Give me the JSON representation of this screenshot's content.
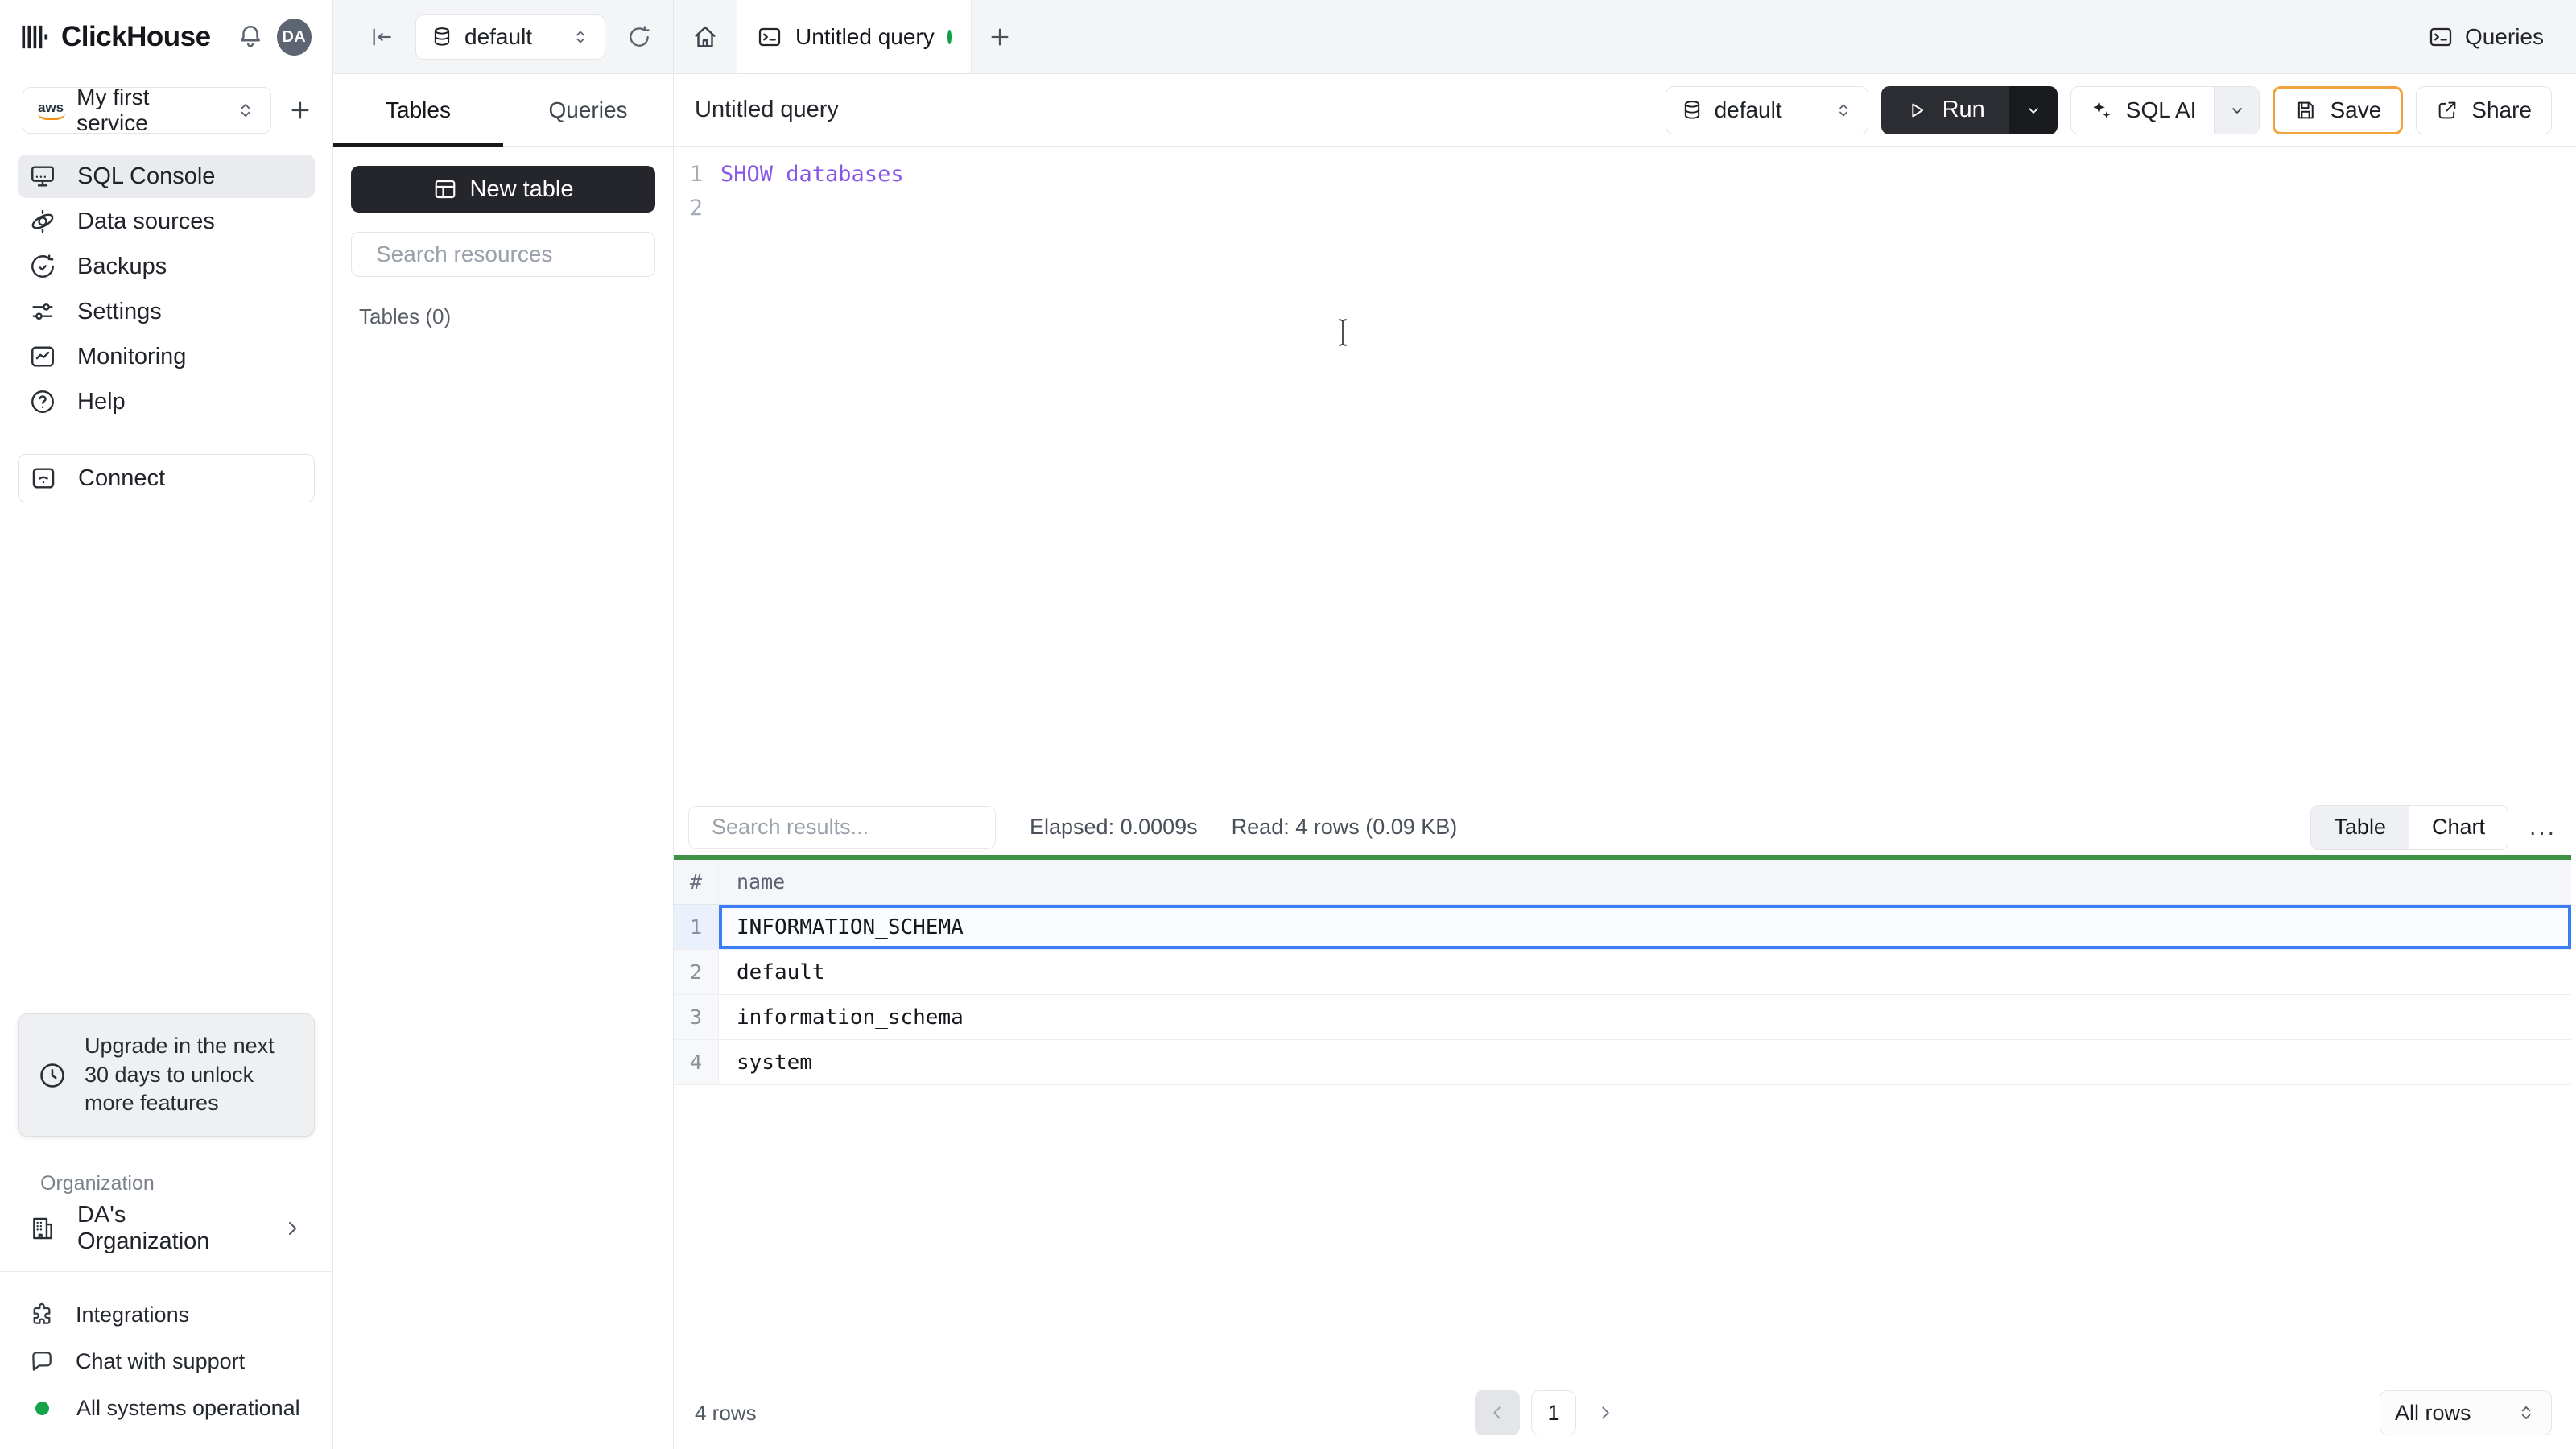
{
  "header": {
    "brand": "ClickHouse",
    "avatar_initials": "DA",
    "queries_button": "Queries"
  },
  "topbar": {
    "database": "default",
    "tab_title": "Untitled query"
  },
  "sidebar": {
    "service": "My first service",
    "items": [
      {
        "label": "SQL Console"
      },
      {
        "label": "Data sources"
      },
      {
        "label": "Backups"
      },
      {
        "label": "Settings"
      },
      {
        "label": "Monitoring"
      },
      {
        "label": "Help"
      }
    ],
    "connect": "Connect",
    "upgrade": "Upgrade in the next 30 days to unlock more features",
    "org_label": "Organization",
    "org_name": "DA's Organization",
    "footer": [
      {
        "label": "Integrations"
      },
      {
        "label": "Chat with support"
      },
      {
        "label": "All systems operational"
      }
    ]
  },
  "explorer": {
    "tab_tables": "Tables",
    "tab_queries": "Queries",
    "new_table": "New table",
    "search_placeholder": "Search resources",
    "tables_count": "Tables (0)"
  },
  "query": {
    "title": "Untitled query",
    "database": "default",
    "run": "Run",
    "sql_ai": "SQL AI",
    "save": "Save",
    "share": "Share"
  },
  "editor": {
    "lines": [
      {
        "num": "1",
        "code": "SHOW databases"
      },
      {
        "num": "2",
        "code": ""
      }
    ]
  },
  "results": {
    "search_placeholder": "Search results...",
    "elapsed": "Elapsed: 0.0009s",
    "read": "Read: 4 rows (0.09 KB)",
    "toggle_table": "Table",
    "toggle_chart": "Chart",
    "more": "...",
    "col_hash": "#",
    "col_name": "name",
    "rows": [
      "INFORMATION_SCHEMA",
      "default",
      "information_schema",
      "system"
    ],
    "row_count": "4 rows",
    "page": "1",
    "page_size": "All rows"
  },
  "colors": {
    "accent_dark": "#24262b",
    "save_border": "#f2a33c",
    "sql_keyword_purple": "#8657e8",
    "selected_row_blue": "#3b7cf7",
    "results_green_bar": "#3e9142",
    "status_green": "#16a34a"
  }
}
